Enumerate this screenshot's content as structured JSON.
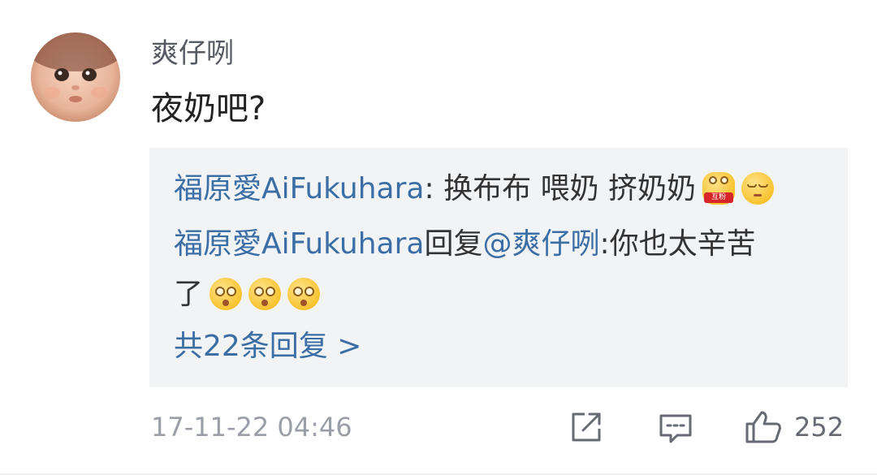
{
  "comment": {
    "username": "爽仔咧",
    "text": "夜奶吧?",
    "timestamp": "17-11-22 04:46",
    "like_count": "252",
    "avatar": "baby-avatar"
  },
  "replies": {
    "items": [
      {
        "author": "福原愛AiFukuhara",
        "separator": ": ",
        "text": "换布布 喂奶 挤奶奶",
        "emojis": [
          "fan-badge-emoji",
          "sleepy-face-emoji"
        ],
        "fan_badge_text": "互粉"
      },
      {
        "author": "福原愛AiFukuhara",
        "reply_word": "回复",
        "mention": "@爽仔咧",
        "text_line1": ":你也太辛苦",
        "text_line2": "了",
        "emojis": [
          "dizzy-face-emoji",
          "dizzy-face-emoji",
          "dizzy-face-emoji"
        ]
      }
    ],
    "more_label": "共22条回复 >"
  },
  "icons": {
    "share": "share-icon",
    "comment": "comment-icon",
    "like": "thumbs-up-icon"
  },
  "colors": {
    "link": "#3a6ea5",
    "reply_background": "#f2f3f5",
    "meta_text": "#9a9ea6"
  }
}
